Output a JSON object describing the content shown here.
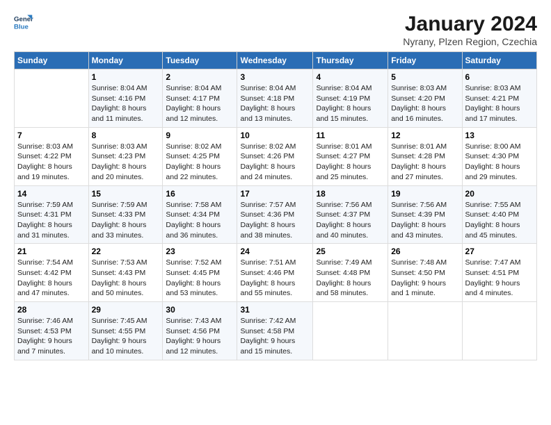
{
  "logo": {
    "line1": "General",
    "line2": "Blue"
  },
  "title": "January 2024",
  "subtitle": "Nyrany, Plzen Region, Czechia",
  "days_header": [
    "Sunday",
    "Monday",
    "Tuesday",
    "Wednesday",
    "Thursday",
    "Friday",
    "Saturday"
  ],
  "weeks": [
    [
      {
        "num": "",
        "text": ""
      },
      {
        "num": "1",
        "text": "Sunrise: 8:04 AM\nSunset: 4:16 PM\nDaylight: 8 hours\nand 11 minutes."
      },
      {
        "num": "2",
        "text": "Sunrise: 8:04 AM\nSunset: 4:17 PM\nDaylight: 8 hours\nand 12 minutes."
      },
      {
        "num": "3",
        "text": "Sunrise: 8:04 AM\nSunset: 4:18 PM\nDaylight: 8 hours\nand 13 minutes."
      },
      {
        "num": "4",
        "text": "Sunrise: 8:04 AM\nSunset: 4:19 PM\nDaylight: 8 hours\nand 15 minutes."
      },
      {
        "num": "5",
        "text": "Sunrise: 8:03 AM\nSunset: 4:20 PM\nDaylight: 8 hours\nand 16 minutes."
      },
      {
        "num": "6",
        "text": "Sunrise: 8:03 AM\nSunset: 4:21 PM\nDaylight: 8 hours\nand 17 minutes."
      }
    ],
    [
      {
        "num": "7",
        "text": "Sunrise: 8:03 AM\nSunset: 4:22 PM\nDaylight: 8 hours\nand 19 minutes."
      },
      {
        "num": "8",
        "text": "Sunrise: 8:03 AM\nSunset: 4:23 PM\nDaylight: 8 hours\nand 20 minutes."
      },
      {
        "num": "9",
        "text": "Sunrise: 8:02 AM\nSunset: 4:25 PM\nDaylight: 8 hours\nand 22 minutes."
      },
      {
        "num": "10",
        "text": "Sunrise: 8:02 AM\nSunset: 4:26 PM\nDaylight: 8 hours\nand 24 minutes."
      },
      {
        "num": "11",
        "text": "Sunrise: 8:01 AM\nSunset: 4:27 PM\nDaylight: 8 hours\nand 25 minutes."
      },
      {
        "num": "12",
        "text": "Sunrise: 8:01 AM\nSunset: 4:28 PM\nDaylight: 8 hours\nand 27 minutes."
      },
      {
        "num": "13",
        "text": "Sunrise: 8:00 AM\nSunset: 4:30 PM\nDaylight: 8 hours\nand 29 minutes."
      }
    ],
    [
      {
        "num": "14",
        "text": "Sunrise: 7:59 AM\nSunset: 4:31 PM\nDaylight: 8 hours\nand 31 minutes."
      },
      {
        "num": "15",
        "text": "Sunrise: 7:59 AM\nSunset: 4:33 PM\nDaylight: 8 hours\nand 33 minutes."
      },
      {
        "num": "16",
        "text": "Sunrise: 7:58 AM\nSunset: 4:34 PM\nDaylight: 8 hours\nand 36 minutes."
      },
      {
        "num": "17",
        "text": "Sunrise: 7:57 AM\nSunset: 4:36 PM\nDaylight: 8 hours\nand 38 minutes."
      },
      {
        "num": "18",
        "text": "Sunrise: 7:56 AM\nSunset: 4:37 PM\nDaylight: 8 hours\nand 40 minutes."
      },
      {
        "num": "19",
        "text": "Sunrise: 7:56 AM\nSunset: 4:39 PM\nDaylight: 8 hours\nand 43 minutes."
      },
      {
        "num": "20",
        "text": "Sunrise: 7:55 AM\nSunset: 4:40 PM\nDaylight: 8 hours\nand 45 minutes."
      }
    ],
    [
      {
        "num": "21",
        "text": "Sunrise: 7:54 AM\nSunset: 4:42 PM\nDaylight: 8 hours\nand 47 minutes."
      },
      {
        "num": "22",
        "text": "Sunrise: 7:53 AM\nSunset: 4:43 PM\nDaylight: 8 hours\nand 50 minutes."
      },
      {
        "num": "23",
        "text": "Sunrise: 7:52 AM\nSunset: 4:45 PM\nDaylight: 8 hours\nand 53 minutes."
      },
      {
        "num": "24",
        "text": "Sunrise: 7:51 AM\nSunset: 4:46 PM\nDaylight: 8 hours\nand 55 minutes."
      },
      {
        "num": "25",
        "text": "Sunrise: 7:49 AM\nSunset: 4:48 PM\nDaylight: 8 hours\nand 58 minutes."
      },
      {
        "num": "26",
        "text": "Sunrise: 7:48 AM\nSunset: 4:50 PM\nDaylight: 9 hours\nand 1 minute."
      },
      {
        "num": "27",
        "text": "Sunrise: 7:47 AM\nSunset: 4:51 PM\nDaylight: 9 hours\nand 4 minutes."
      }
    ],
    [
      {
        "num": "28",
        "text": "Sunrise: 7:46 AM\nSunset: 4:53 PM\nDaylight: 9 hours\nand 7 minutes."
      },
      {
        "num": "29",
        "text": "Sunrise: 7:45 AM\nSunset: 4:55 PM\nDaylight: 9 hours\nand 10 minutes."
      },
      {
        "num": "30",
        "text": "Sunrise: 7:43 AM\nSunset: 4:56 PM\nDaylight: 9 hours\nand 12 minutes."
      },
      {
        "num": "31",
        "text": "Sunrise: 7:42 AM\nSunset: 4:58 PM\nDaylight: 9 hours\nand 15 minutes."
      },
      {
        "num": "",
        "text": ""
      },
      {
        "num": "",
        "text": ""
      },
      {
        "num": "",
        "text": ""
      }
    ]
  ]
}
